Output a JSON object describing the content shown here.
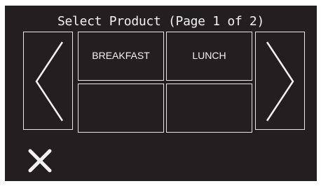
{
  "screen": {
    "title": "Select Product (Page 1 of 2)",
    "prev_icon": "chevron-left-icon",
    "next_icon": "chevron-right-icon",
    "close_icon": "close-icon",
    "products": [
      {
        "label": "BREAKFAST"
      },
      {
        "label": "LUNCH"
      },
      {
        "label": ""
      },
      {
        "label": ""
      }
    ]
  },
  "colors": {
    "background": "#231f20",
    "foreground": "#f2f2f2"
  }
}
